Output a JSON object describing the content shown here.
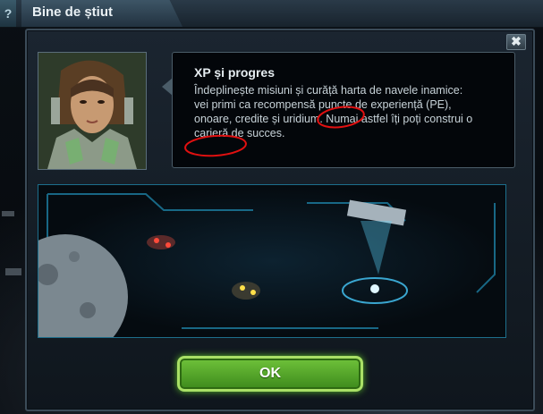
{
  "header": {
    "help_label": "?",
    "title": "Bine de știut"
  },
  "dialog": {
    "close_label": "✖",
    "info_title": "XP și progres",
    "info_text": "Îndeplinește misiuni și curăță harta de navele inamice: vei primi ca recompensă puncte de experiență (PE), onoare, credite și uridium. Numai astfel îți poți construi o carieră de succes.",
    "ok_label": "OK"
  },
  "colors": {
    "ok_green": "#5ab52a",
    "frame_blue": "#1d6f8c",
    "annotation_red": "#e01010"
  }
}
